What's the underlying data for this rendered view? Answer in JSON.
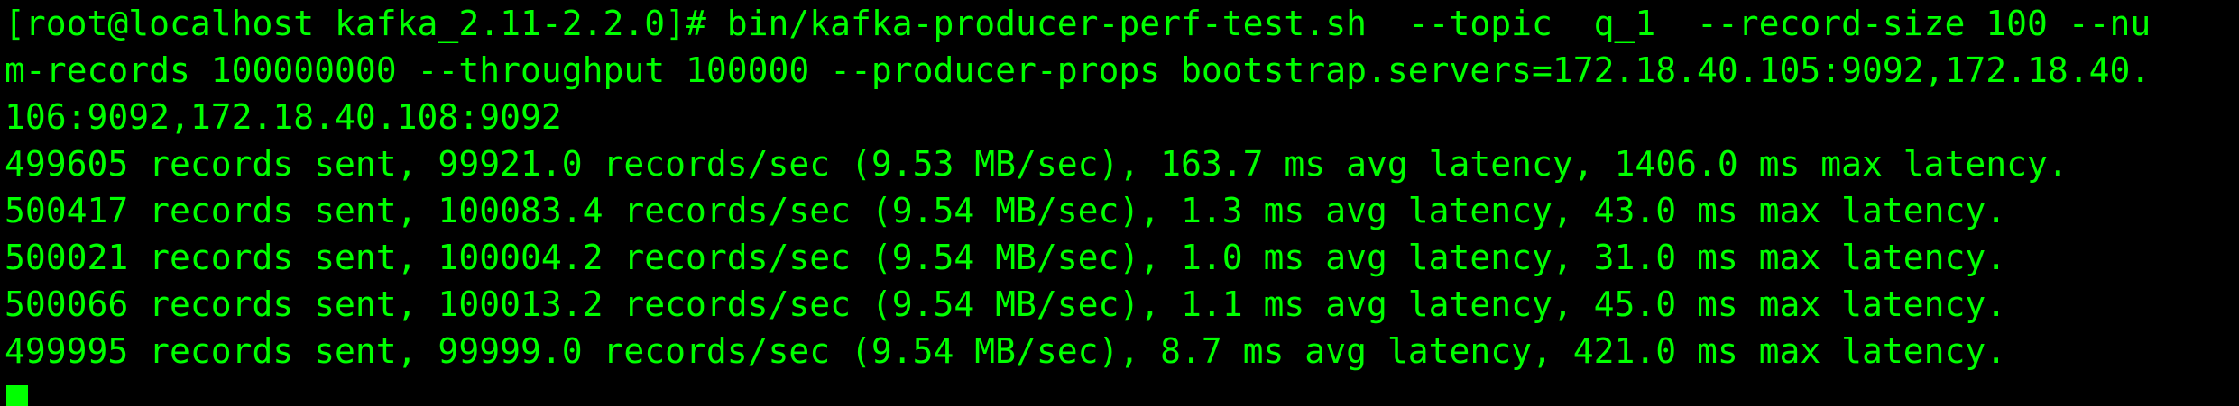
{
  "terminal": {
    "text_color": "#00ff00",
    "background_color": "#000000",
    "lines": [
      "[root@localhost kafka_2.11-2.2.0]# bin/kafka-producer-perf-test.sh  --topic  q_1  --record-size 100 --nu",
      "m-records 100000000 --throughput 100000 --producer-props bootstrap.servers=172.18.40.105:9092,172.18.40.",
      "106:9092,172.18.40.108:9092",
      "499605 records sent, 99921.0 records/sec (9.53 MB/sec), 163.7 ms avg latency, 1406.0 ms max latency.",
      "500417 records sent, 100083.4 records/sec (9.54 MB/sec), 1.3 ms avg latency, 43.0 ms max latency.",
      "500021 records sent, 100004.2 records/sec (9.54 MB/sec), 1.0 ms avg latency, 31.0 ms max latency.",
      "500066 records sent, 100013.2 records/sec (9.54 MB/sec), 1.1 ms avg latency, 45.0 ms max latency.",
      "499995 records sent, 99999.0 records/sec (9.54 MB/sec), 8.7 ms avg latency, 421.0 ms max latency."
    ]
  }
}
